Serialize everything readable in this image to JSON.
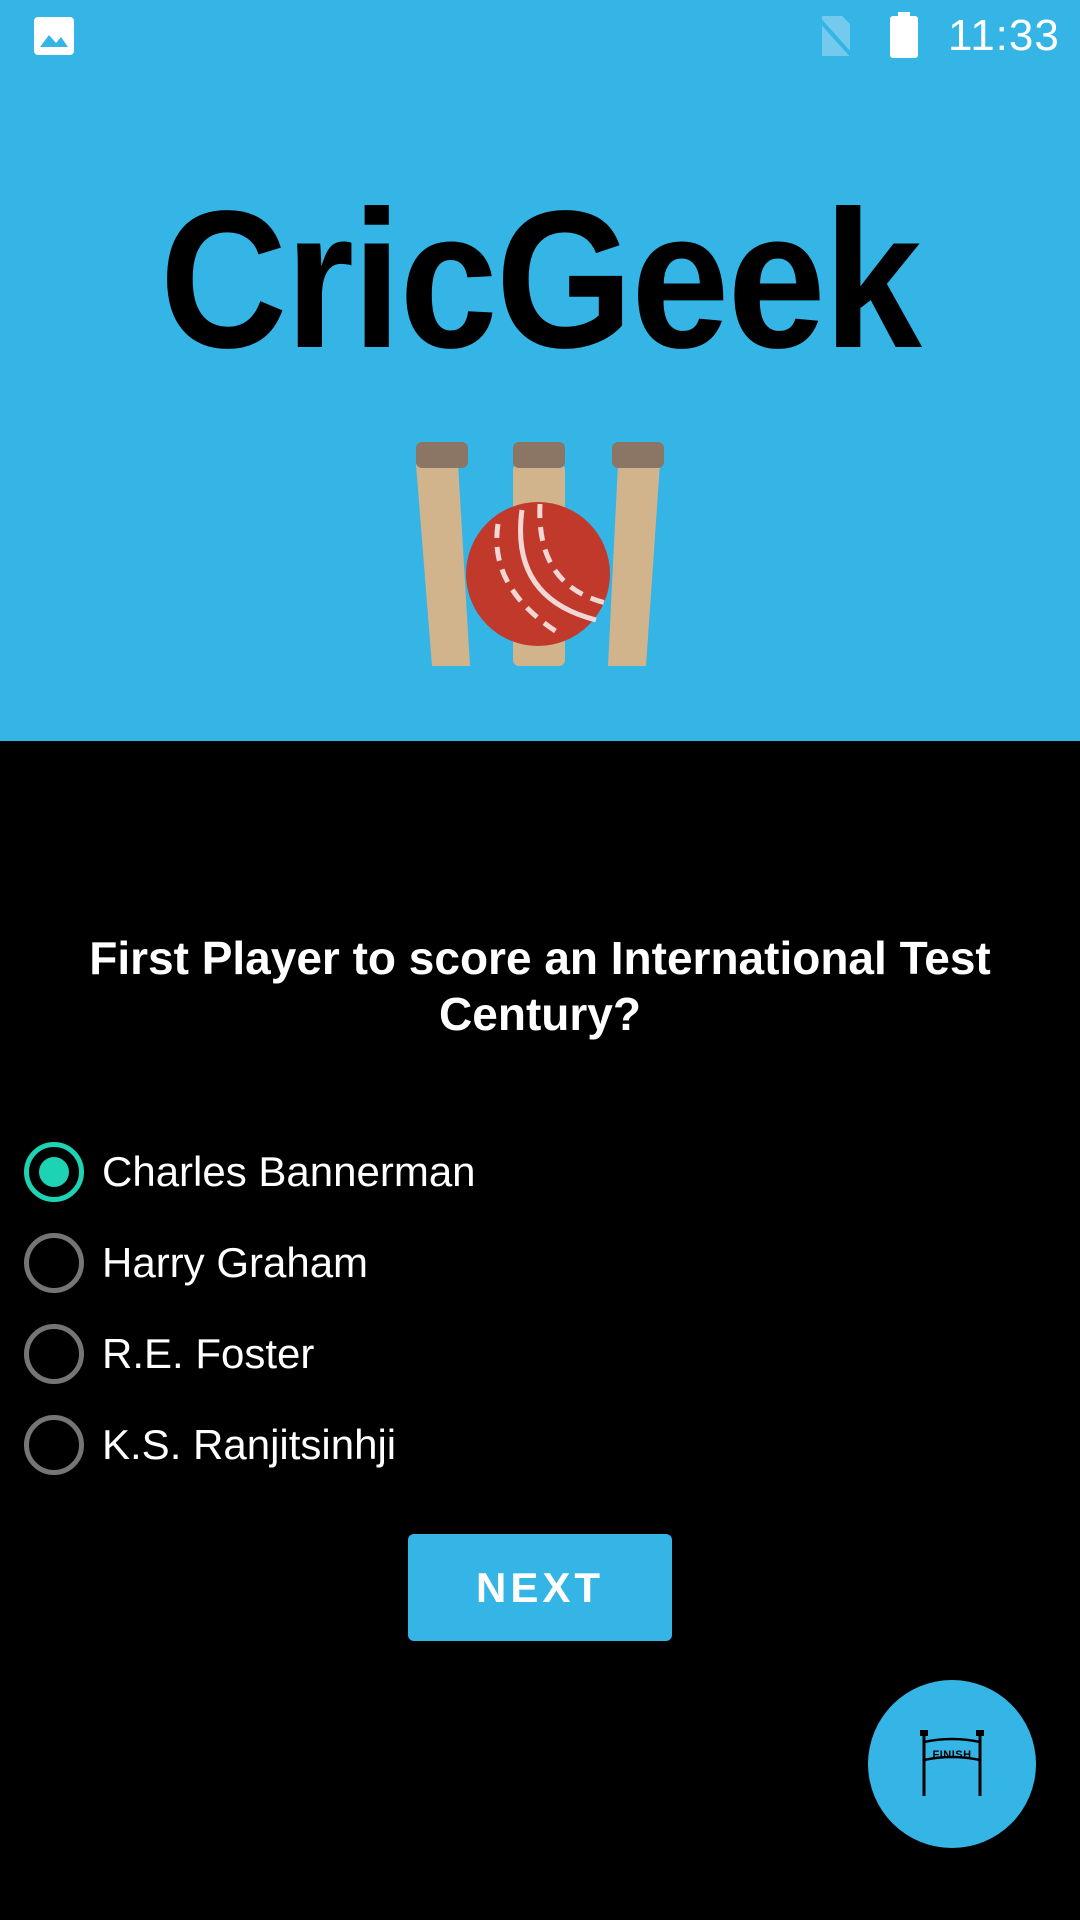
{
  "status_bar": {
    "time": "11:33",
    "icons": [
      "gallery-icon",
      "no-sim-icon",
      "battery-icon"
    ]
  },
  "app": {
    "title": "CricGeek",
    "logo": "cricket-wickets-ball-logo"
  },
  "quiz": {
    "question": "First Player to score an International Test Century?",
    "options": [
      {
        "label": "Charles Bannerman",
        "selected": true
      },
      {
        "label": "Harry Graham",
        "selected": false
      },
      {
        "label": "R.E. Foster",
        "selected": false
      },
      {
        "label": "K.S. Ranjitsinhji",
        "selected": false
      }
    ],
    "next_label": "NEXT"
  },
  "fab": {
    "icon": "finish-line-icon",
    "label": "FINISH"
  },
  "colors": {
    "header_bg": "#35B5E6",
    "screen_bg": "#000000",
    "radio_checked": "#1ED2B4",
    "radio_unchecked": "#757575",
    "button_bg": "#35B5E6"
  }
}
